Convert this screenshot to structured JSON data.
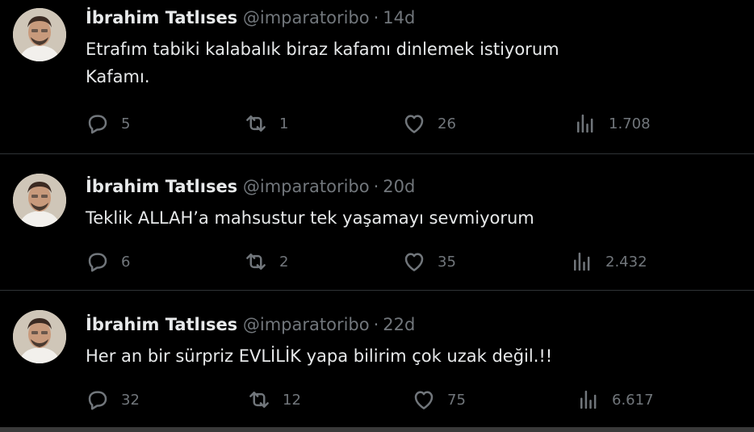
{
  "tweets": [
    {
      "name": "İbrahim Tatlıses",
      "handle": "@imparatoribo",
      "dot": "·",
      "time": "14d",
      "lines": [
        "Etrafım tabiki kalabalık biraz kafamı dinlemek istiyorum",
        "Kafamı."
      ],
      "replies": "5",
      "retweets": "1",
      "likes": "26",
      "views": "1.708"
    },
    {
      "name": "İbrahim Tatlıses",
      "handle": "@imparatoribo",
      "dot": "·",
      "time": "20d",
      "lines": [
        "Teklik ALLAH’a mahsustur tek yaşamayı sevmiyorum"
      ],
      "replies": "6",
      "retweets": "2",
      "likes": "35",
      "views": "2.432"
    },
    {
      "name": "İbrahim Tatlıses",
      "handle": "@imparatoribo",
      "dot": "·",
      "time": "22d",
      "lines": [
        "Her an bir sürpriz  EVLİLİK yapa bilirim çok uzak değil.!!"
      ],
      "replies": "32",
      "retweets": "12",
      "likes": "75",
      "views": "6.617"
    }
  ],
  "icons": {
    "reply": "reply-icon",
    "retweet": "retweet-icon",
    "like": "heart-icon",
    "views": "views-icon"
  },
  "colors": {
    "background": "#000000",
    "text": "#e7e9ea",
    "muted": "#71767b",
    "divider": "#2f3336"
  }
}
